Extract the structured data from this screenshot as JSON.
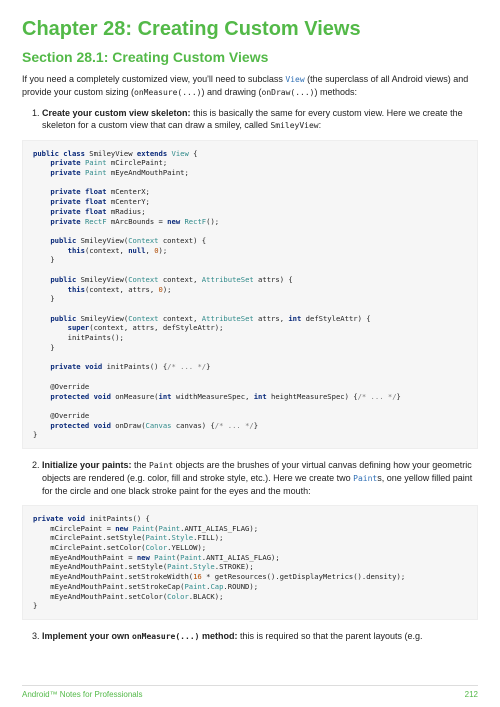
{
  "chapter": {
    "title": "Chapter 28: Creating Custom Views"
  },
  "section": {
    "title": "Section 28.1: Creating Custom Views"
  },
  "intro": {
    "pre_link": "If you need a completely customized view, you'll need to subclass ",
    "link": "View",
    "post_link": " (the superclass of all Android views) and provide your custom sizing (",
    "code1": "onMeasure(...)",
    "mid": ") and drawing (",
    "code2": "onDraw(...)",
    "tail": ") methods:"
  },
  "steps": {
    "one": {
      "bold": "Create your custom view skeleton:",
      "rest": " this is basically the same for every custom view. Here we create the skeleton for a custom view that can draw a smiley, called ",
      "code": "SmileyView",
      "tail": ":"
    },
    "two": {
      "bold": "Initialize your paints:",
      "rest_pre": " the ",
      "code1": "Paint",
      "rest_mid": " objects are the brushes of your virtual canvas defining how your geometric objects are rendered (e.g. color, fill and stroke style, etc.). Here we create two ",
      "code2": "Paint",
      "rest_post": "s, one yellow filled paint for the circle and one black stroke paint for the eyes and the mouth:"
    },
    "three": {
      "bold": "Implement your own ",
      "boldcode": "onMeasure(...)",
      "bold2": " method:",
      "rest": " this is required so that the parent layouts (e.g."
    }
  },
  "code1": {
    "class_name": "SmileyView",
    "method_initPaints": "initPaints",
    "method_onMeasure": "onMeasure",
    "method_onDraw": "onDraw"
  },
  "footer": {
    "left": "Android™ Notes for Professionals",
    "right": "212"
  }
}
